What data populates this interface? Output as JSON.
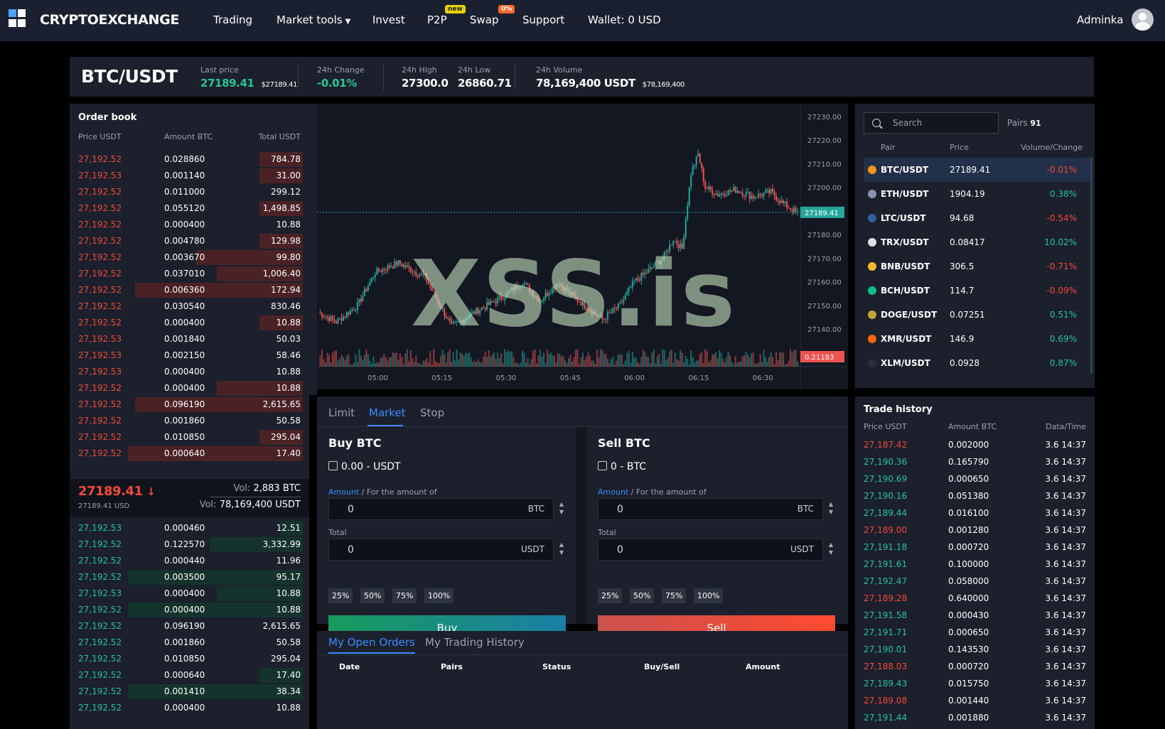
{
  "nav": {
    "brand": "CRYPTOEXCHANGE",
    "items": [
      "Trading",
      "Market tools",
      "Invest",
      "P2P",
      "Swap",
      "Support",
      "Wallet: 0 USD"
    ],
    "badge_p2p": "new",
    "badge_swap": "0%",
    "username": "Adminka"
  },
  "ticker": {
    "pair": "BTC/USDT",
    "last_price_label": "Last price",
    "last_price": "27189.41",
    "last_price_usd": "$27189.41",
    "change_label": "24h Change",
    "change": "-0.01%",
    "high_label": "24h High",
    "high": "27300.0",
    "low_label": "24h Low",
    "low": "26860.71",
    "volume_label": "24h Volume",
    "volume": "78,169,400 USDT",
    "volume_usd": "$78,169,400"
  },
  "orderbook": {
    "title": "Order book",
    "headers": [
      "Price USDT",
      "Amount BTC",
      "Total USDT"
    ],
    "asks": [
      {
        "price": "27,192.52",
        "amount": "0.028860",
        "total": "784.78",
        "depth": 0.19
      },
      {
        "price": "27,192.53",
        "amount": "0.001140",
        "total": "31.00",
        "depth": 0.19
      },
      {
        "price": "27,192.52",
        "amount": "0.011000",
        "total": "299.12",
        "depth": 0.0
      },
      {
        "price": "27,192.52",
        "amount": "0.055120",
        "total": "1,498.85",
        "depth": 0.19
      },
      {
        "price": "27,192.52",
        "amount": "0.000400",
        "total": "10.88",
        "depth": 0.0
      },
      {
        "price": "27,192.52",
        "amount": "0.004780",
        "total": "129.98",
        "depth": 0.19
      },
      {
        "price": "27,192.52",
        "amount": "0.003670",
        "total": "99.80",
        "depth": 0.47
      },
      {
        "price": "27,192.52",
        "amount": "0.037010",
        "total": "1,006.40",
        "depth": 0.38
      },
      {
        "price": "27,192.52",
        "amount": "0.006360",
        "total": "172.94",
        "depth": 0.74
      },
      {
        "price": "27,192.52",
        "amount": "0.030540",
        "total": "830.46",
        "depth": 0.0
      },
      {
        "price": "27,192.52",
        "amount": "0.000400",
        "total": "10.88",
        "depth": 0.19
      },
      {
        "price": "27,192.53",
        "amount": "0.001840",
        "total": "50.03",
        "depth": 0.0
      },
      {
        "price": "27,192.53",
        "amount": "0.002150",
        "total": "58.46",
        "depth": 0.0
      },
      {
        "price": "27,192.53",
        "amount": "0.000400",
        "total": "10.88",
        "depth": 0.0
      },
      {
        "price": "27,192.52",
        "amount": "0.000400",
        "total": "10.88",
        "depth": 0.38
      },
      {
        "price": "27,192.52",
        "amount": "0.096190",
        "total": "2,615.65",
        "depth": 0.74
      },
      {
        "price": "27,192.52",
        "amount": "0.001860",
        "total": "50.58",
        "depth": 0.0
      },
      {
        "price": "27,192.52",
        "amount": "0.010850",
        "total": "295.04",
        "depth": 0.19
      },
      {
        "price": "27,192.52",
        "amount": "0.000640",
        "total": "17.40",
        "depth": 0.77
      }
    ],
    "mid_price": "27189.41",
    "mid_arrow": "↓",
    "mid_usd": "27189.41 USD",
    "vol_btc_label": "Vol:",
    "vol_btc": "2,883 BTC",
    "vol_usdt_label": "Vol:",
    "vol_usdt": "78,169,400 USDT",
    "bids": [
      {
        "price": "27,192.53",
        "amount": "0.000460",
        "total": "12.51",
        "depth": 0.1
      },
      {
        "price": "27,192.52",
        "amount": "0.122570",
        "total": "3,332.99",
        "depth": 0.41
      },
      {
        "price": "27,192.52",
        "amount": "0.000440",
        "total": "11.96",
        "depth": 0.0
      },
      {
        "price": "27,192.52",
        "amount": "0.003500",
        "total": "95.17",
        "depth": 0.77
      },
      {
        "price": "27,192.53",
        "amount": "0.000400",
        "total": "10.88",
        "depth": 0.38
      },
      {
        "price": "27,192.52",
        "amount": "0.000400",
        "total": "10.88",
        "depth": 0.77
      },
      {
        "price": "27,192.52",
        "amount": "0.096190",
        "total": "2,615.65",
        "depth": 0.0
      },
      {
        "price": "27,192.52",
        "amount": "0.001860",
        "total": "50.58",
        "depth": 0.0
      },
      {
        "price": "27,192.52",
        "amount": "0.010850",
        "total": "295.04",
        "depth": 0.0
      },
      {
        "price": "27,192.52",
        "amount": "0.000640",
        "total": "17.40",
        "depth": 0.19
      },
      {
        "price": "27,192.52",
        "amount": "0.001410",
        "total": "38.34",
        "depth": 0.77
      },
      {
        "price": "27,192.52",
        "amount": "0.000400",
        "total": "10.88",
        "depth": 0.0
      }
    ]
  },
  "chart_data": {
    "type": "candlestick",
    "title": "",
    "y_ticks": [
      "27230.00",
      "27220.00",
      "27210.00",
      "27200.00",
      "27190.00",
      "27180.00",
      "27170.00",
      "27160.00",
      "27150.00",
      "27140.00"
    ],
    "ylim": [
      27135,
      27232
    ],
    "x_ticks": [
      "05:00",
      "05:15",
      "05:30",
      "05:45",
      "06:00",
      "06:15",
      "06:30"
    ],
    "last_price": "27189.41",
    "volume_label": "0.21183",
    "volume_color_up": "#26a69a",
    "volume_color_down": "#ef5350",
    "watermark": "XSS.is"
  },
  "order_form": {
    "tabs": [
      "Limit",
      "Market",
      "Stop"
    ],
    "active_tab": "Market",
    "buy": {
      "title": "Buy BTC",
      "balance": "0.00 - USDT",
      "amount_label": "Amount",
      "amount_sub": " / For the amount of",
      "amount_value": "0",
      "amount_cur": "BTC",
      "total_label": "Total",
      "total_value": "0",
      "total_cur": "USDT",
      "button": "Buy"
    },
    "sell": {
      "title": "Sell BTC",
      "balance": "0 - BTC",
      "amount_label": "Amount",
      "amount_sub": " / For the amount of",
      "amount_value": "0",
      "amount_cur": "BTC",
      "total_label": "Total",
      "total_value": "0",
      "total_cur": "USDT",
      "button": "Sell"
    },
    "percentages": [
      "25%",
      "50%",
      "75%",
      "100%"
    ]
  },
  "orders": {
    "tabs": [
      "My Open Orders",
      "My Trading History"
    ],
    "columns": [
      "Date",
      "Pairs",
      "Status",
      "Buy/Sell",
      "Amount"
    ]
  },
  "markets": {
    "search_placeholder": "Search",
    "pairs_label": "Pairs",
    "pairs_count": "91",
    "headers": [
      "Pair",
      "Price",
      "Volume/Change"
    ],
    "rows": [
      {
        "pair": "BTC/USDT",
        "price": "27189.41",
        "change": "-0.01%",
        "dir": "down",
        "icon": "btc-icon",
        "color": "#f7931a"
      },
      {
        "pair": "ETH/USDT",
        "price": "1904.19",
        "change": "0.38%",
        "dir": "up",
        "icon": "eth-icon",
        "color": "#8a92b2"
      },
      {
        "pair": "LTC/USDT",
        "price": "94.68",
        "change": "-0.54%",
        "dir": "down",
        "icon": "ltc-icon",
        "color": "#345d9d"
      },
      {
        "pair": "TRX/USDT",
        "price": "0.08417",
        "change": "10.02%",
        "dir": "up",
        "icon": "trx-icon",
        "color": "#e0e0e0"
      },
      {
        "pair": "BNB/USDT",
        "price": "306.5",
        "change": "-0.71%",
        "dir": "down",
        "icon": "bnb-icon",
        "color": "#f3ba2f"
      },
      {
        "pair": "BCH/USDT",
        "price": "114.7",
        "change": "-0.09%",
        "dir": "down",
        "icon": "bch-icon",
        "color": "#0ac18e"
      },
      {
        "pair": "DOGE/USDT",
        "price": "0.07251",
        "change": "0.51%",
        "dir": "up",
        "icon": "doge-icon",
        "color": "#c2a633"
      },
      {
        "pair": "XMR/USDT",
        "price": "146.9",
        "change": "0.69%",
        "dir": "up",
        "icon": "xmr-icon",
        "color": "#ff6600"
      },
      {
        "pair": "XLM/USDT",
        "price": "0.0928",
        "change": "0.87%",
        "dir": "up",
        "icon": "xlm-icon",
        "color": "#2a2f3a"
      }
    ]
  },
  "trade_history": {
    "title": "Trade history",
    "headers": [
      "Price USDT",
      "Amount BTC",
      "Data/Time"
    ],
    "rows": [
      {
        "price": "27,187.42",
        "amount": "0.002000",
        "time": "3.6 14:37",
        "dir": "down"
      },
      {
        "price": "27,190.36",
        "amount": "0.165790",
        "time": "3.6 14:37",
        "dir": "up"
      },
      {
        "price": "27,190.69",
        "amount": "0.000650",
        "time": "3.6 14:37",
        "dir": "up"
      },
      {
        "price": "27,190.16",
        "amount": "0.051380",
        "time": "3.6 14:37",
        "dir": "up"
      },
      {
        "price": "27,189.44",
        "amount": "0.016100",
        "time": "3.6 14:37",
        "dir": "up"
      },
      {
        "price": "27,189.00",
        "amount": "0.001280",
        "time": "3.6 14:37",
        "dir": "down"
      },
      {
        "price": "27,191.18",
        "amount": "0.000720",
        "time": "3.6 14:37",
        "dir": "up"
      },
      {
        "price": "27,191.61",
        "amount": "0.100000",
        "time": "3.6 14:37",
        "dir": "up"
      },
      {
        "price": "27,192.47",
        "amount": "0.058000",
        "time": "3.6 14:37",
        "dir": "up"
      },
      {
        "price": "27,189.28",
        "amount": "0.640000",
        "time": "3.6 14:37",
        "dir": "down"
      },
      {
        "price": "27,191.58",
        "amount": "0.000430",
        "time": "3.6 14:37",
        "dir": "up"
      },
      {
        "price": "27,191.71",
        "amount": "0.000650",
        "time": "3.6 14:37",
        "dir": "up"
      },
      {
        "price": "27,190.01",
        "amount": "0.143530",
        "time": "3.6 14:37",
        "dir": "up"
      },
      {
        "price": "27,188.03",
        "amount": "0.000720",
        "time": "3.6 14:37",
        "dir": "down"
      },
      {
        "price": "27,189.43",
        "amount": "0.015750",
        "time": "3.6 14:37",
        "dir": "up"
      },
      {
        "price": "27,189.08",
        "amount": "0.001440",
        "time": "3.6 14:37",
        "dir": "down"
      },
      {
        "price": "27,191.44",
        "amount": "0.001880",
        "time": "3.6 14:37",
        "dir": "up"
      }
    ]
  },
  "colors": {
    "up": "#28c49a",
    "down": "#f2493a",
    "accent": "#3b8cff"
  }
}
